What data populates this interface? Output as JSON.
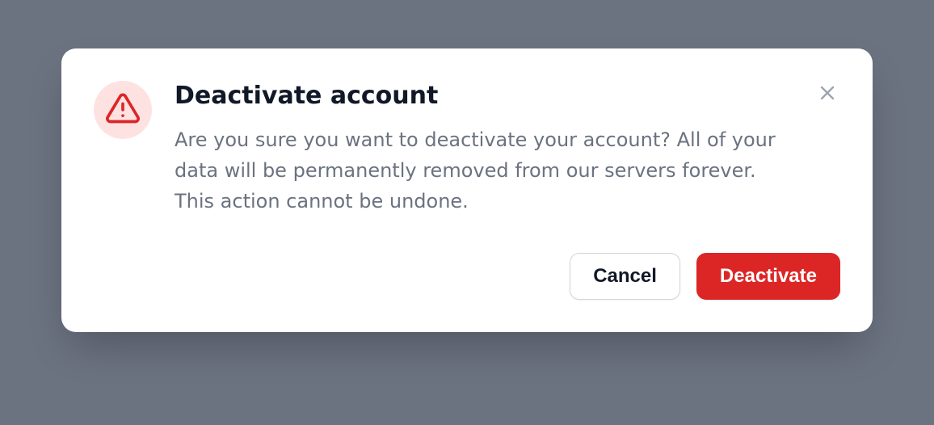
{
  "modal": {
    "title": "Deactivate account",
    "description": "Are you sure you want to deactivate your account? All of your data will be permanently removed from our servers forever. This action cannot be undone.",
    "cancel_label": "Cancel",
    "confirm_label": "Deactivate"
  }
}
